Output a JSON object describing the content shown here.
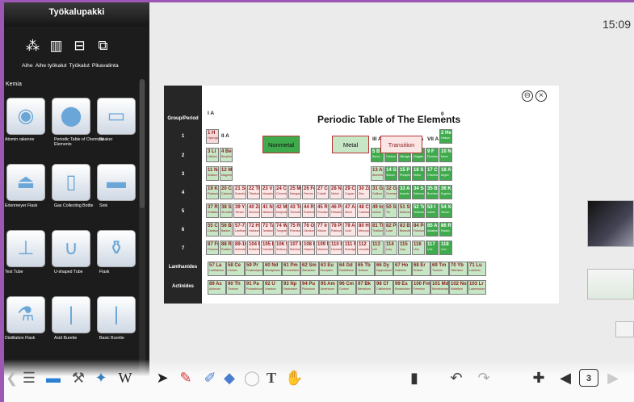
{
  "panel": {
    "title": "Työkalupakki",
    "tools": [
      "Aihe",
      "Aihe työkalut",
      "Työkalut",
      "Pikavalinta"
    ],
    "section": "Kemia",
    "items": [
      "Atomin rakenne",
      "Periodic Table of Chemical Elements",
      "Beaker",
      "Erlenmeyer Flask",
      "Gas Collecting Bottle",
      "Sink",
      "Test Tube",
      "U-shaped Tube",
      "Flask",
      "Distillation Flask",
      "Acid Burette",
      "Basic Burette"
    ]
  },
  "clock": "15:09",
  "periodic": {
    "title": "Periodic Table of The Elements",
    "side_labels": [
      "Group/Period",
      "1",
      "2",
      "3",
      "4",
      "5",
      "6",
      "7",
      "Lanthanides",
      "Actinides"
    ],
    "group_headers": [
      "I A",
      "II A",
      "III B",
      "IV B",
      "V B",
      "VI B",
      "VII B",
      "VIII",
      "I B",
      "II B",
      "III A",
      "IV A",
      "V A",
      "VI A",
      "VII A",
      "0"
    ],
    "legend": [
      "Nonmetal",
      "Metal",
      "Transition"
    ],
    "rows": [
      [
        [
          "1",
          "H",
          "Hydrogen",
          "n"
        ],
        null,
        null,
        null,
        null,
        null,
        null,
        null,
        null,
        null,
        null,
        null,
        null,
        null,
        null,
        null,
        null,
        [
          "2",
          "He",
          "Helium",
          "g"
        ]
      ],
      [
        [
          "3",
          "Li",
          "Lithium",
          "m"
        ],
        [
          "4",
          "Be",
          "Beryllium",
          "m"
        ],
        null,
        null,
        null,
        null,
        null,
        null,
        null,
        null,
        null,
        null,
        [
          "5",
          "B",
          "Boron",
          "g"
        ],
        [
          "6",
          "C",
          "Carbon",
          "g"
        ],
        [
          "7",
          "N",
          "Nitrogen",
          "g"
        ],
        [
          "8",
          "O",
          "Oxygen",
          "g"
        ],
        [
          "9",
          "F",
          "Fluorine",
          "g"
        ],
        [
          "10",
          "Ne",
          "Neon",
          "g"
        ]
      ],
      [
        [
          "11",
          "Na",
          "Sodium",
          "m"
        ],
        [
          "12",
          "Mg",
          "Magnesium",
          "m"
        ],
        null,
        null,
        null,
        null,
        null,
        null,
        null,
        null,
        null,
        null,
        [
          "13",
          "Al",
          "Aluminium",
          "m"
        ],
        [
          "14",
          "Si",
          "Silicon",
          "g"
        ],
        [
          "15",
          "P",
          "Phosphorus",
          "g"
        ],
        [
          "16",
          "S",
          "Sulfur",
          "g"
        ],
        [
          "17",
          "Cl",
          "Chlorine",
          "g"
        ],
        [
          "18",
          "Ar",
          "Argon",
          "g"
        ]
      ],
      [
        [
          "19",
          "K",
          "Potassium",
          "m"
        ],
        [
          "20",
          "Ca",
          "Calcium",
          "m"
        ],
        [
          "21",
          "Sc",
          "Scandium",
          "t"
        ],
        [
          "22",
          "Ti",
          "Titanium",
          "t"
        ],
        [
          "23",
          "V",
          "Vanadium",
          "t"
        ],
        [
          "24",
          "Cr",
          "Chromium",
          "t"
        ],
        [
          "25",
          "Mn",
          "Manganese",
          "t"
        ],
        [
          "26",
          "Fe",
          "Ferrum",
          "t"
        ],
        [
          "27",
          "Co",
          "Cobalt",
          "t"
        ],
        [
          "28",
          "Ni",
          "Nickel",
          "t"
        ],
        [
          "29",
          "Cu",
          "Copper",
          "t"
        ],
        [
          "30",
          "Zn",
          "Zinc",
          "t"
        ],
        [
          "31",
          "Ga",
          "Gallium",
          "m"
        ],
        [
          "32",
          "Ge",
          "Germanium",
          "m"
        ],
        [
          "33",
          "As",
          "Arsenic",
          "g"
        ],
        [
          "34",
          "Se",
          "Selenium",
          "g"
        ],
        [
          "35",
          "Br",
          "Bromine",
          "g"
        ],
        [
          "36",
          "Kr",
          "Krypton",
          "g"
        ]
      ],
      [
        [
          "37",
          "Rb",
          "Rubidium",
          "m"
        ],
        [
          "38",
          "Sr",
          "Strontium",
          "m"
        ],
        [
          "39",
          "Y",
          "Yttrium",
          "t"
        ],
        [
          "40",
          "Zr",
          "Zirconium",
          "t"
        ],
        [
          "41",
          "Nb",
          "Niobium",
          "t"
        ],
        [
          "42",
          "Mo",
          "Molybdenum",
          "t"
        ],
        [
          "43",
          "Tc",
          "Technetium",
          "t"
        ],
        [
          "44",
          "Ru",
          "Ruthenium",
          "t"
        ],
        [
          "45",
          "Rh",
          "Rhodium",
          "t"
        ],
        [
          "46",
          "Pd",
          "Palladium",
          "t"
        ],
        [
          "47",
          "Ag",
          "Silver",
          "t"
        ],
        [
          "48",
          "Cd",
          "Cadmium",
          "t"
        ],
        [
          "49",
          "In",
          "Indium",
          "m"
        ],
        [
          "50",
          "Sn",
          "Tin",
          "m"
        ],
        [
          "51",
          "Sb",
          "Antimony",
          "m"
        ],
        [
          "52",
          "Te",
          "Tellurium",
          "g"
        ],
        [
          "53",
          "I",
          "Iodine",
          "g"
        ],
        [
          "54",
          "Xe",
          "Xenon",
          "g"
        ]
      ],
      [
        [
          "55",
          "Cs",
          "Caesium",
          "m"
        ],
        [
          "56",
          "Ba",
          "Barium",
          "m"
        ],
        [
          "57-71",
          "La",
          "Lanthanides",
          "t"
        ],
        [
          "72",
          "Hf",
          "Hafnium",
          "t"
        ],
        [
          "73",
          "Ta",
          "Tantalum",
          "t"
        ],
        [
          "74",
          "W",
          "Tungsten",
          "t"
        ],
        [
          "75",
          "Re",
          "Rhenium",
          "t"
        ],
        [
          "76",
          "Os",
          "Osmium",
          "t"
        ],
        [
          "77",
          "Ir",
          "Iridium",
          "t"
        ],
        [
          "78",
          "Pt",
          "Platinum",
          "t"
        ],
        [
          "79",
          "Au",
          "Gold",
          "t"
        ],
        [
          "80",
          "Hg",
          "Mercury",
          "t"
        ],
        [
          "81",
          "Tl",
          "Thallium",
          "m"
        ],
        [
          "82",
          "Pb",
          "Lead",
          "m"
        ],
        [
          "83",
          "Bi",
          "Bismuth",
          "m"
        ],
        [
          "84",
          "Po",
          "Polonium",
          "m"
        ],
        [
          "85",
          "At",
          "Astatine",
          "g"
        ],
        [
          "86",
          "Rn",
          "Radon",
          "g"
        ]
      ],
      [
        [
          "87",
          "Fr",
          "Francium",
          "m"
        ],
        [
          "88",
          "Ra",
          "Radium",
          "m"
        ],
        [
          "89-103",
          "Ac",
          "Actinides",
          "t"
        ],
        [
          "104",
          "Rf",
          "Rutherfordium",
          "t"
        ],
        [
          "105",
          "Db",
          "Dubnium",
          "t"
        ],
        [
          "106",
          "Sg",
          "Seaborgium",
          "t"
        ],
        [
          "107",
          "Bh",
          "Bohrium",
          "t"
        ],
        [
          "108",
          "Hs",
          "Hassium",
          "t"
        ],
        [
          "109",
          "Mt",
          "Meitnerium",
          "t"
        ],
        [
          "110",
          "Ds",
          "Darmstadtium",
          "t"
        ],
        [
          "111",
          "Rg",
          "Roentgenium",
          "t"
        ],
        [
          "112",
          "",
          "Ununbium",
          "t"
        ],
        [
          "113",
          "",
          "Uut",
          "m"
        ],
        [
          "114",
          "",
          "Uuq",
          "m"
        ],
        [
          "115",
          "",
          "Uup",
          "m"
        ],
        [
          "116",
          "",
          "Uuh",
          "m"
        ],
        [
          "117",
          "",
          "Uus",
          "g"
        ],
        [
          "118",
          "",
          "Uuo",
          "g"
        ]
      ]
    ],
    "lanthanides": [
      [
        "57",
        "La",
        "Lanthanum"
      ],
      [
        "58",
        "Ce",
        "Cerium"
      ],
      [
        "59",
        "Pr",
        "Praseodymium"
      ],
      [
        "60",
        "Nd",
        "Neodymium"
      ],
      [
        "61",
        "Pm",
        "Promethium"
      ],
      [
        "62",
        "Sm",
        "Samarium"
      ],
      [
        "63",
        "Eu",
        "Europium"
      ],
      [
        "64",
        "Gd",
        "Gadolinium"
      ],
      [
        "65",
        "Tb",
        "Terbium"
      ],
      [
        "66",
        "Dy",
        "Dysprosium"
      ],
      [
        "67",
        "Ho",
        "Holmium"
      ],
      [
        "68",
        "Er",
        "Erbium"
      ],
      [
        "69",
        "Tm",
        "Thulium"
      ],
      [
        "70",
        "Yb",
        "Ytterbium"
      ],
      [
        "71",
        "Lu",
        "Lutetium"
      ]
    ],
    "actinides": [
      [
        "89",
        "Ac",
        "Actinium"
      ],
      [
        "90",
        "Th",
        "Thorium"
      ],
      [
        "91",
        "Pa",
        "Protactinium"
      ],
      [
        "92",
        "U",
        "Uranium"
      ],
      [
        "93",
        "Np",
        "Neptunium"
      ],
      [
        "94",
        "Pu",
        "Plutonium"
      ],
      [
        "95",
        "Am",
        "Americium"
      ],
      [
        "96",
        "Cm",
        "Curium"
      ],
      [
        "97",
        "Bk",
        "Berkelium"
      ],
      [
        "98",
        "Cf",
        "Californium"
      ],
      [
        "99",
        "Es",
        "Einsteinium"
      ],
      [
        "100",
        "Fm",
        "Fermium"
      ],
      [
        "101",
        "Md",
        "Mendelevium"
      ],
      [
        "102",
        "No",
        "Nobelium"
      ],
      [
        "103",
        "Lr",
        "Lawrencium"
      ]
    ]
  },
  "colors": {
    "nonmetal": "#3fab4d",
    "metal": "#c6e6c6",
    "transition": "#fbe6e6",
    "accent": "#9c58b4"
  },
  "taskbar": {
    "icons": [
      "menu-icon",
      "screen-icon",
      "tools-icon",
      "media-icon",
      "wikipedia-icon",
      "pointer-icon",
      "pen-icon",
      "highlighter-icon",
      "eraser-icon",
      "shape-icon",
      "text-icon",
      "hand-icon",
      "page-icon",
      "undo-icon",
      "redo-icon",
      "add-page-icon",
      "prev-page-icon",
      "page-number-icon"
    ],
    "wiki_label": "W",
    "text_tool_label": "T",
    "page_label": "3"
  }
}
